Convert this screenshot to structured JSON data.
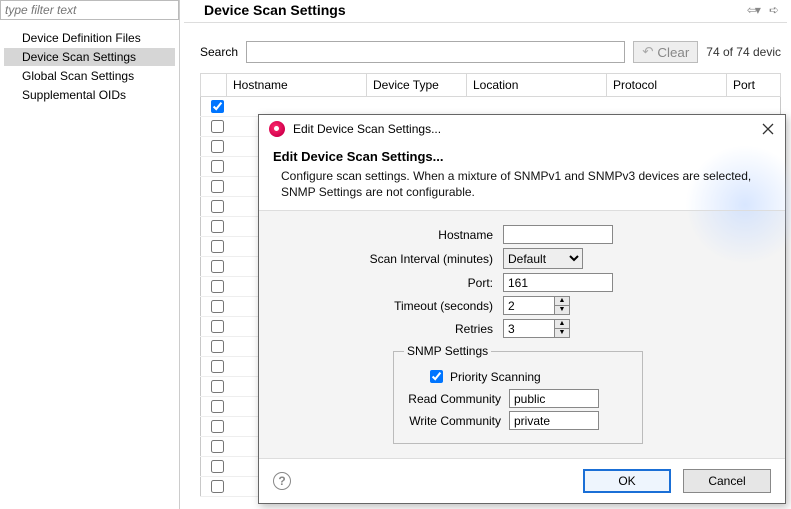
{
  "sidebar": {
    "filter_placeholder": "type filter text",
    "items": [
      {
        "label": "Device Definition Files"
      },
      {
        "label": "Device Scan Settings",
        "selected": true
      },
      {
        "label": "Global Scan Settings"
      },
      {
        "label": "Supplemental OIDs"
      }
    ]
  },
  "page": {
    "title": "Device Scan Settings",
    "search_label": "Search",
    "clear_label": "Clear",
    "count_text": "74 of 74 devic"
  },
  "table": {
    "columns": [
      "Hostname",
      "Device Type",
      "Location",
      "Protocol",
      "Port"
    ],
    "row_count": 20,
    "first_row_checked": true
  },
  "dialog": {
    "window_title": "Edit Device Scan Settings...",
    "heading": "Edit Device Scan Settings...",
    "description": "Configure scan settings.  When a mixture of SNMPv1 and SNMPv3 devices are selected, SNMP Settings are not configurable.",
    "fields": {
      "hostname_label": "Hostname",
      "hostname_value": "",
      "interval_label": "Scan Interval (minutes)",
      "interval_value": "Default",
      "port_label": "Port:",
      "port_value": "161",
      "timeout_label": "Timeout (seconds)",
      "timeout_value": "2",
      "retries_label": "Retries",
      "retries_value": "3"
    },
    "snmp": {
      "legend": "SNMP Settings",
      "priority_label": "Priority Scanning",
      "priority_checked": true,
      "read_label": "Read Community",
      "read_value": "public",
      "write_label": "Write Community",
      "write_value": "private"
    },
    "buttons": {
      "ok": "OK",
      "cancel": "Cancel"
    }
  }
}
